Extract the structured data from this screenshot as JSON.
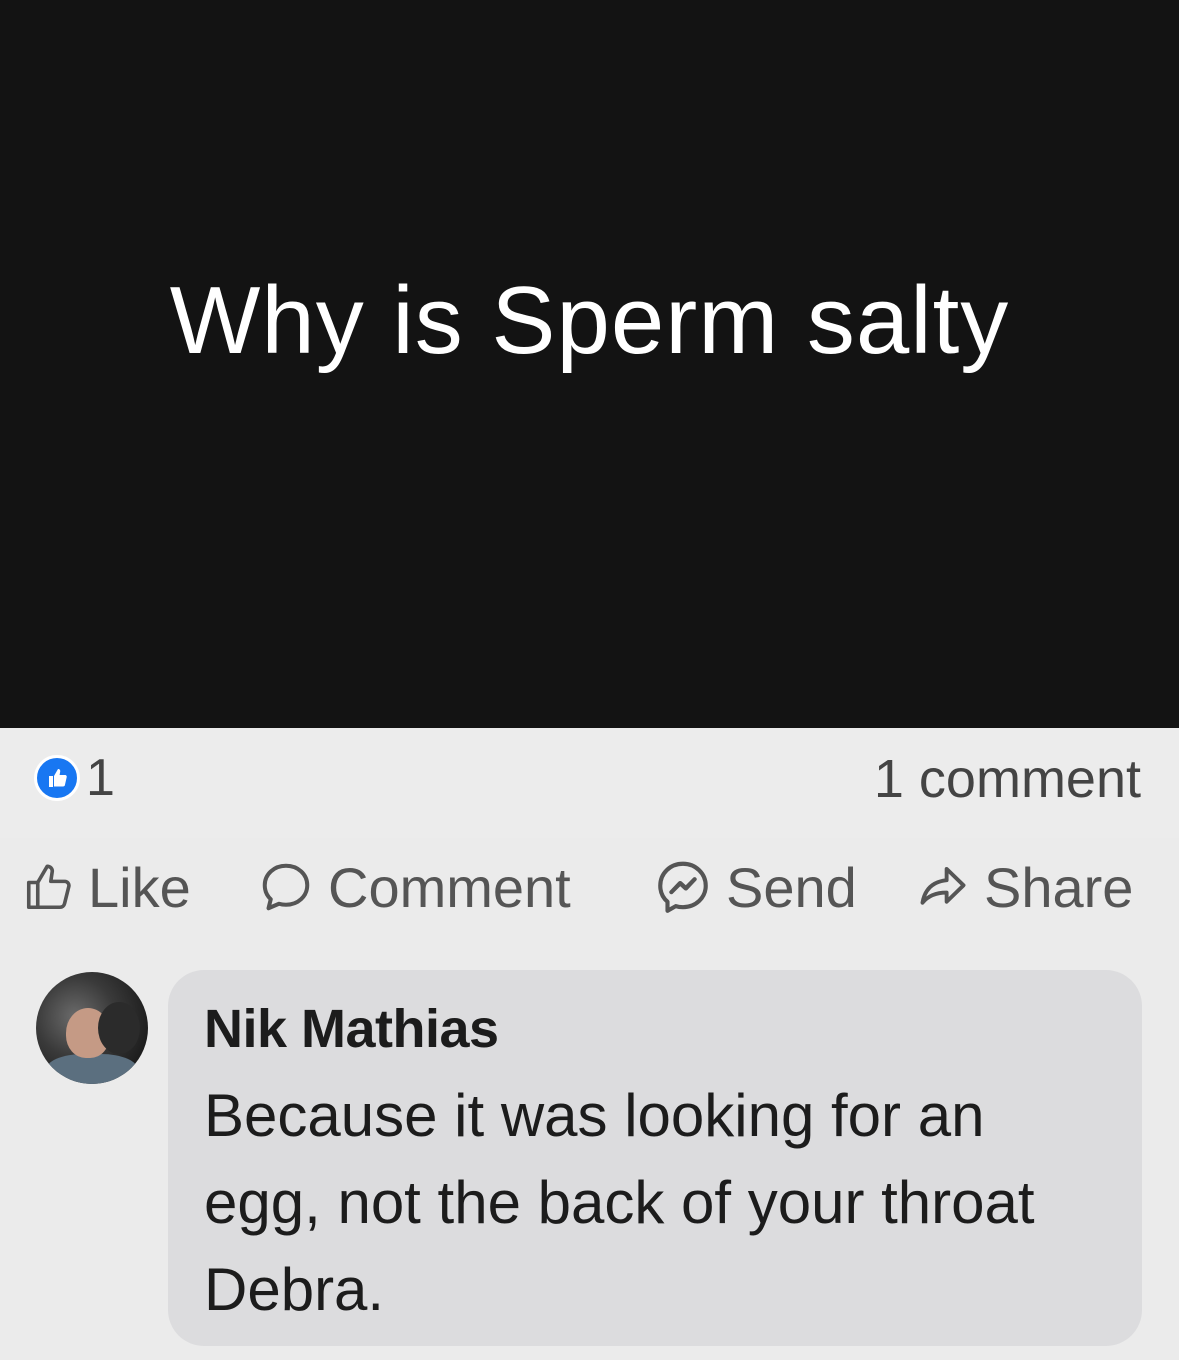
{
  "post": {
    "image_text": "Why is Sperm salty"
  },
  "stats": {
    "like_count": "1",
    "comment_count": "1 comment"
  },
  "actions": {
    "like": "Like",
    "comment": "Comment",
    "send": "Send",
    "share": "Share"
  },
  "comment": {
    "author": "Nik Mathias",
    "text": "Because it was looking for an egg, not the back of your throat Debra."
  },
  "colors": {
    "image_bg": "#131313",
    "like_blue": "#1877f2",
    "bubble_bg": "#dcdcde",
    "page_bg": "#ebebeb"
  },
  "icons": [
    "thumbs-up-icon",
    "comment-icon",
    "messenger-icon",
    "share-icon"
  ]
}
